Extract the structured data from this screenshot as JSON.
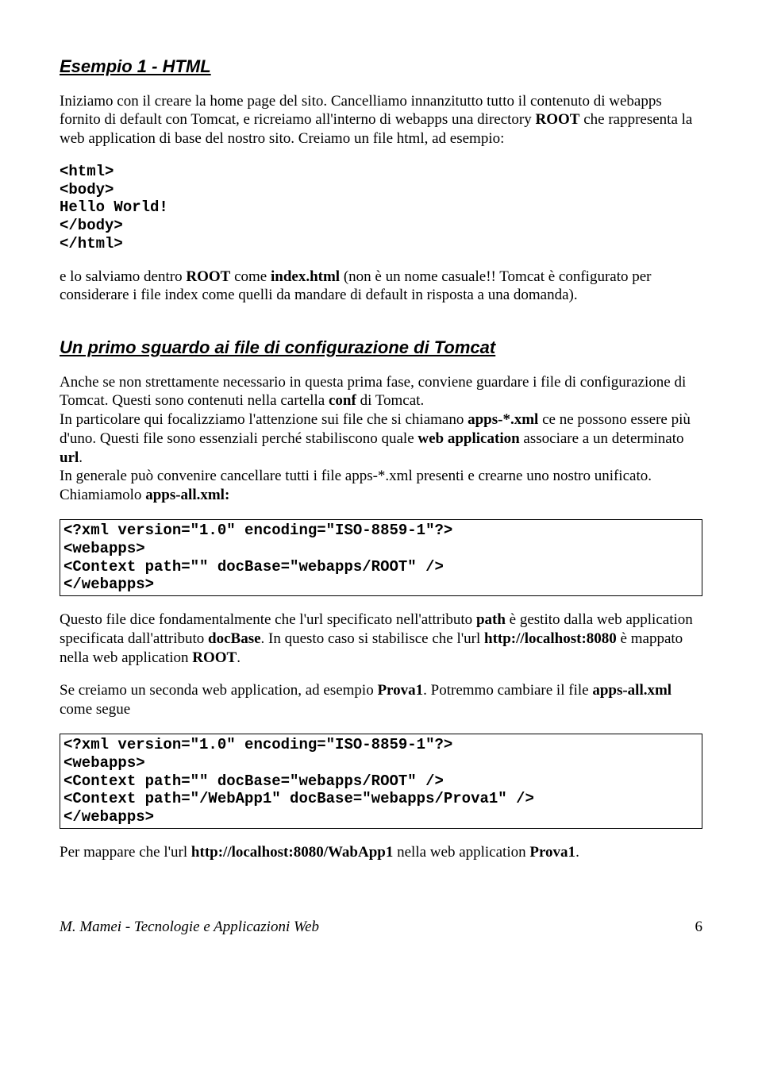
{
  "h1": "Esempio 1 - HTML",
  "p1a": "Iniziamo con il creare la home page del sito. Cancelliamo innanzitutto tutto il contenuto di webapps fornito di default con Tomcat, e ricreiamo all'interno di webapps una directory ",
  "p1b": "ROOT",
  "p1c": " che rappresenta la web application di base del nostro sito. Creiamo un file html, ad esempio:",
  "code1": "<html>\n<body>\nHello World!\n</body>\n</html>",
  "p2a": "e lo salviamo dentro ",
  "p2b": "ROOT",
  "p2c": " come ",
  "p2d": "index.html",
  "p2e": " (non è un nome casuale!! Tomcat è configurato per considerare i file index come quelli da mandare di default in risposta a una domanda).",
  "h2": "Un primo sguardo ai file di configurazione di Tomcat",
  "p3a": "Anche se non strettamente necessario in questa prima fase, conviene guardare i file di configurazione di Tomcat. Questi sono contenuti nella cartella ",
  "p3b": "conf",
  "p3c": " di Tomcat.",
  "p4a": "In particolare qui focalizziamo l'attenzione sui file che si chiamano ",
  "p4b": "apps-*.xml",
  "p4c": " ce ne possono essere più d'uno. Questi file sono essenziali perché stabiliscono quale ",
  "p4d": "web application",
  "p4e": " associare a un determinato ",
  "p4f": "url",
  "p4g": ".",
  "p5a": "In generale può convenire cancellare tutti i file apps-*.xml presenti e crearne uno nostro unificato. Chiamiamolo ",
  "p5b": "apps-all.xml:",
  "code2": "<?xml version=\"1.0\" encoding=\"ISO-8859-1\"?>\n<webapps>\n<Context path=\"\" docBase=\"webapps/ROOT\" />\n</webapps>",
  "p6a": "Questo file dice fondamentalmente che l'url specificato nell'attributo ",
  "p6b": "path",
  "p6c": " è gestito dalla web application specificata dall'attributo ",
  "p6d": "docBase",
  "p6e": ". In questo caso si stabilisce che l'url ",
  "p6f": "http://localhost:8080",
  "p6g": " è mappato nella web application ",
  "p6h": "ROOT",
  "p6i": ".",
  "p7a": "Se creiamo un seconda web application, ad esempio ",
  "p7b": "Prova1",
  "p7c": ". Potremmo cambiare il file ",
  "p7d": "apps-all.xml",
  "p7e": " come segue",
  "code3": "<?xml version=\"1.0\" encoding=\"ISO-8859-1\"?>\n<webapps>\n<Context path=\"\" docBase=\"webapps/ROOT\" />\n<Context path=\"/WebApp1\" docBase=\"webapps/Prova1\" />\n</webapps>",
  "p8a": "Per mappare che l'url ",
  "p8b": "http://localhost:8080/WabApp1",
  "p8c": " nella web application ",
  "p8d": "Prova1",
  "p8e": ".",
  "footer": "M. Mamei - Tecnologie e Applicazioni Web",
  "pagenum": "6"
}
